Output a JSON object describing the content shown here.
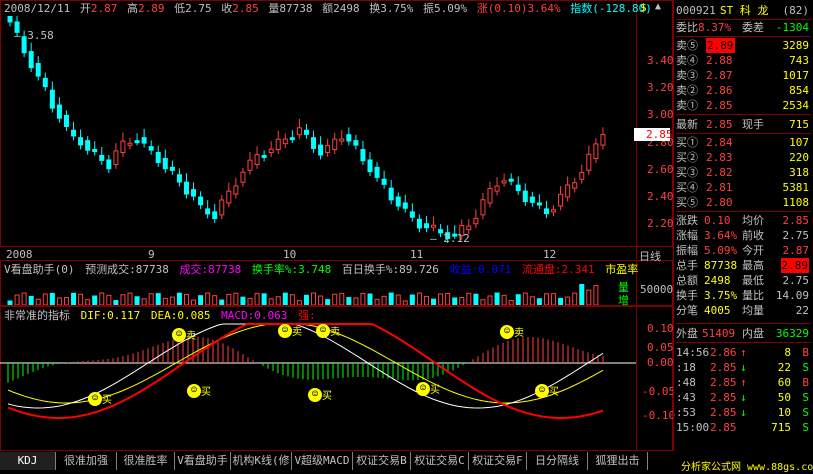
{
  "colors": {
    "up": "#ff4040",
    "down": "#00ffff",
    "ma": "#ffffff",
    "yellow": "#ffff00",
    "green": "#00ff00",
    "magenta": "#ff00ff",
    "border": "#800000"
  },
  "kline": {
    "date": "2008/12/11",
    "open_label": "开",
    "open": "2.87",
    "high_label": "高",
    "high": "2.89",
    "low_label": "低",
    "low": "2.75",
    "close_label": "收",
    "close": "2.85",
    "volume_label": "量",
    "volume": "87738",
    "amount_label": "额",
    "amount": "2498",
    "turnover_label": "换",
    "turnover": "3.75%",
    "amplitude_label": "振",
    "amplitude": "5.09%",
    "change_label": "涨",
    "change": "(0.10)3.64%",
    "index_label": "指数",
    "index": "(-128.80)",
    "high_mark": "3.58",
    "low_mark": "2.12",
    "last_mark": "2.85",
    "y_ticks": [
      "3.40",
      "3.20",
      "3.00",
      "2.80",
      "2.60",
      "2.40",
      "2.20"
    ],
    "months": [
      "2008",
      "9",
      "10",
      "11",
      "12"
    ],
    "period": "日线"
  },
  "chart_data": [
    {
      "type": "candlestick",
      "title": "ST 科 龙",
      "ylim": [
        2.1,
        3.6
      ],
      "y_ticks": [
        3.4,
        3.2,
        3.0,
        2.8,
        2.6,
        2.4,
        2.2
      ],
      "x_labels": [
        "2008",
        "9",
        "10",
        "11",
        "12"
      ],
      "high_point": 3.58,
      "low_point": 2.12,
      "last": 2.85
    },
    {
      "type": "bar",
      "title": "V看盘助手",
      "y_ticks": [
        50000
      ],
      "legend": [
        "量",
        "增"
      ]
    },
    {
      "type": "line",
      "title": "非常准的指标",
      "ylim": [
        -0.15,
        0.15
      ],
      "y_ticks": [
        0.1,
        0.05,
        0.0,
        -0.05,
        -0.1
      ],
      "series": [
        {
          "name": "DIF",
          "last": 0.117
        },
        {
          "name": "DEA",
          "last": 0.085
        },
        {
          "name": "MACD",
          "last": 0.063
        }
      ],
      "annotations": [
        "买",
        "卖"
      ]
    }
  ],
  "vol": {
    "title": "V看盘助手(0)",
    "pred_label": "预测成交:",
    "pred": "87738",
    "vol_label": "成交:",
    "vol": "87738",
    "turn_label": "换手率%:",
    "turn": "3.748",
    "day100_label": "百日换手%:",
    "day100": "89.726",
    "profit_label": "收益:",
    "profit": "0.071",
    "float_label": "流通盘:",
    "float": "2.341",
    "pe_label": "市盈率",
    "tick": "50000",
    "legend_vol": "量",
    "legend_inc": "增"
  },
  "macd": {
    "title": "非常准的指标",
    "dif_label": "DIF:",
    "dif": "0.117",
    "dea_label": "DEA:",
    "dea": "0.085",
    "macd_label": "MACD:",
    "macd": "0.063",
    "strong_label": "强:",
    "y_ticks": [
      "0.10",
      "0.05",
      "0.00",
      "-0.05",
      "-0.10"
    ],
    "buy": "买",
    "sell": "卖"
  },
  "quote": {
    "code": "000921",
    "name": "ST 科 龙",
    "num": "(82)",
    "weibi_label": "委比",
    "weibi": "8.37%",
    "weicha_label": "委差",
    "weicha": "-1304",
    "sells": [
      {
        "label": "卖⑤",
        "price": "2.89",
        "vol": "3289"
      },
      {
        "label": "卖④",
        "price": "2.88",
        "vol": "743"
      },
      {
        "label": "卖③",
        "price": "2.87",
        "vol": "1017"
      },
      {
        "label": "卖②",
        "price": "2.86",
        "vol": "854"
      },
      {
        "label": "卖①",
        "price": "2.85",
        "vol": "2534"
      }
    ],
    "latest_label": "最新",
    "latest": "2.85",
    "cur_label": "现手",
    "cur": "715",
    "buys": [
      {
        "label": "买①",
        "price": "2.84",
        "vol": "107"
      },
      {
        "label": "买②",
        "price": "2.83",
        "vol": "220"
      },
      {
        "label": "买③",
        "price": "2.82",
        "vol": "318"
      },
      {
        "label": "买④",
        "price": "2.81",
        "vol": "5381"
      },
      {
        "label": "买⑤",
        "price": "2.80",
        "vol": "1108"
      }
    ],
    "stats": [
      {
        "l1": "涨跌",
        "v1": "0.10",
        "l2": "均价",
        "v2": "2.85"
      },
      {
        "l1": "涨幅",
        "v1": "3.64%",
        "l2": "前收",
        "v2": "2.75"
      },
      {
        "l1": "振幅",
        "v1": "5.09%",
        "l2": "今开",
        "v2": "2.87"
      },
      {
        "l1": "总手",
        "v1": "87738",
        "l2": "最高",
        "v2": "2.89"
      },
      {
        "l1": "总额",
        "v1": "2498",
        "l2": "最低",
        "v2": "2.75"
      },
      {
        "l1": "换手",
        "v1": "3.75%",
        "l2": "量比",
        "v2": "14.09"
      },
      {
        "l1": "分笔",
        "v1": "4005",
        "l2": "均量",
        "v2": "22"
      }
    ],
    "outer_label": "外盘",
    "outer": "51409",
    "inner_label": "内盘",
    "inner": "36329",
    "ticks": [
      {
        "t": "14:56",
        "p": "2.86",
        "d": "↑",
        "v": "8",
        "s": "B"
      },
      {
        "t": ":18",
        "p": "2.85",
        "d": "↓",
        "v": "22",
        "s": "S"
      },
      {
        "t": ":48",
        "p": "2.85",
        "d": "↑",
        "v": "60",
        "s": "B"
      },
      {
        "t": ":43",
        "p": "2.85",
        "d": "↓",
        "v": "50",
        "s": "S"
      },
      {
        "t": ":53",
        "p": "2.85",
        "d": "↓",
        "v": "10",
        "s": "S"
      },
      {
        "t": "15:00",
        "p": "2.85",
        "d": "",
        "v": "715",
        "s": "S"
      }
    ]
  },
  "tabs": [
    "KDJ",
    "很准加强",
    "很准胜率",
    "V看盘助手",
    "机构K线(修",
    "V超级MACD",
    "权证交易B",
    "权证交易C",
    "权证交易F",
    "日分隔线",
    "狐狸出击"
  ],
  "watermark": "分析家公式网 www.88gs.com",
  "top_icon": "$",
  "top_arrow": "▲"
}
